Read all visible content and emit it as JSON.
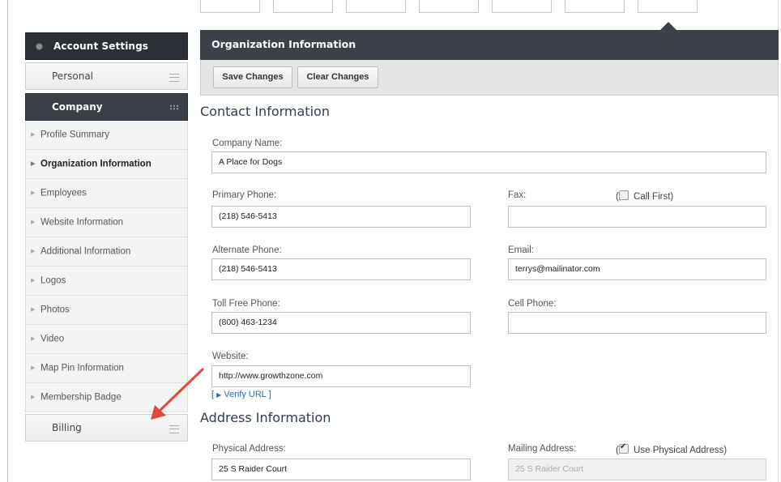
{
  "sidebar": {
    "header_label": "Account Settings",
    "personal_label": "Personal",
    "company_label": "Company",
    "items": [
      {
        "label": "Profile Summary"
      },
      {
        "label": "Organization Information"
      },
      {
        "label": "Employees"
      },
      {
        "label": "Website Information"
      },
      {
        "label": "Additional Information"
      },
      {
        "label": "Logos"
      },
      {
        "label": "Photos"
      },
      {
        "label": "Video"
      },
      {
        "label": "Map Pin Information"
      },
      {
        "label": "Membership Badge"
      }
    ],
    "billing_label": "Billing"
  },
  "main": {
    "title": "Organization Information",
    "save_label": "Save Changes",
    "clear_label": "Clear Changes",
    "contact_title": "Contact Information",
    "address_title": "Address Information",
    "fields": {
      "company_name": {
        "label": "Company Name:",
        "value": "A Place for Dogs"
      },
      "primary_phone": {
        "label": "Primary Phone:",
        "value": "(218) 546-5413"
      },
      "fax": {
        "label": "Fax:",
        "value": ""
      },
      "call_first": {
        "label": "Call First)",
        "open_paren": "(",
        "checked": false
      },
      "alternate_phone": {
        "label": "Alternate Phone:",
        "value": "(218) 546-5413"
      },
      "email": {
        "label": "Email:",
        "value": "terrys@mailinator.com"
      },
      "toll_free_phone": {
        "label": "Toll Free Phone:",
        "value": "(800) 463-1234"
      },
      "cell_phone": {
        "label": "Cell Phone:",
        "value": ""
      },
      "website": {
        "label": "Website:",
        "value": "http://www.growthzone.com"
      },
      "verify_url": {
        "open": "[",
        "label": "Verify URL",
        "close": "]"
      },
      "physical_address": {
        "label": "Physical Address:",
        "value": "25 S Raider Court"
      },
      "mailing_address": {
        "label": "Mailing Address:",
        "value": "25 S Raider Court"
      },
      "use_physical": {
        "label": "Use Physical Address)",
        "open_paren": "(",
        "checked": true
      }
    }
  },
  "colors": {
    "dark_header": "#3c4048",
    "annotation_arrow": "#e04a3a",
    "link": "#2a6db0"
  },
  "icons": {
    "account_dot": "circle-icon",
    "section_menu": "hamburger-icon",
    "company_grid": "grid-icon",
    "item_caret": "caret-right-icon",
    "annotation": "red-arrow-icon"
  }
}
